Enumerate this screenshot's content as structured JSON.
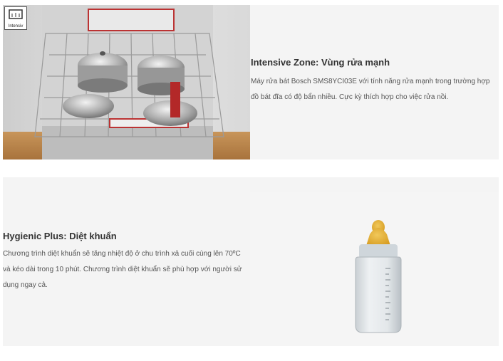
{
  "features": [
    {
      "badge": "Intensiv",
      "title": "Intensive Zone: Vùng rửa mạnh",
      "description": "Máy rửa bát Bosch SMS8YCI03E với tính năng rửa mạnh trong trường hợp đồ bát đĩa có độ bẩn nhiều. Cực kỳ thích hợp cho việc rửa nồi.",
      "image": "dishwasher-basket-with-pots"
    },
    {
      "title": "Hygienic Plus: Diệt khuẩn",
      "description": "Chương trình diệt khuẩn sẽ tăng nhiệt độ ở chu trình xả cuối cùng lên 70ºC và kéo dài trong 10 phút. Chương trình diệt khuẩn sẽ phù hợp với người sử dụng ngay cả.",
      "image": "baby-bottle"
    }
  ]
}
